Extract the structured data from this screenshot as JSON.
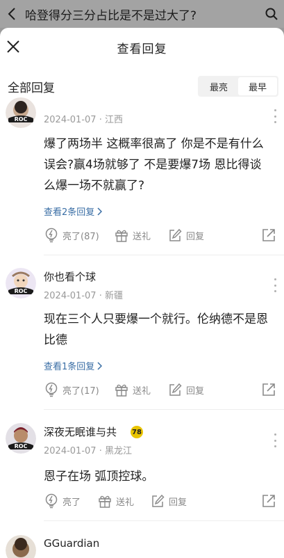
{
  "background_header": {
    "title": "哈登得分三分占比是不是过大了?"
  },
  "sheet": {
    "title": "查看回复",
    "filter_label": "全部回复",
    "sort_options": [
      "最亮",
      "最早"
    ],
    "sort_selected": "最早"
  },
  "comments": [
    {
      "name": "",
      "date": "2024-01-07",
      "location": "江西",
      "text": "爆了两场半 这概率很高了 你是不是有什么误会?赢4场就够了 不是要爆7场 恩比得谈么爆一场不就赢了?",
      "replies": "查看2条回复",
      "like": "亮了(87)",
      "gift": "送礼",
      "reply": "回复"
    },
    {
      "name": "你也看个球",
      "date": "2024-01-07",
      "location": "新疆",
      "text": "现在三个人只要爆一个就行。伦纳德不是恩比德",
      "replies": "查看1条回复",
      "like": "亮了(17)",
      "gift": "送礼",
      "reply": "回复"
    },
    {
      "name": "深夜无眠谁与共",
      "badge": "78",
      "date": "2024-01-07",
      "location": "黑龙江",
      "text": "恩子在场 弧顶控球。",
      "like": "亮了",
      "gift": "送礼",
      "reply": "回复"
    },
    {
      "name": "GGuardian"
    }
  ],
  "separator": "·",
  "icons": {
    "back": "chevron-left-icon",
    "search": "search-icon",
    "close": "close-icon",
    "more": "more-vertical-icon",
    "like": "lightbulb-icon",
    "gift": "gift-icon",
    "reply": "edit-icon",
    "share": "share-icon"
  }
}
